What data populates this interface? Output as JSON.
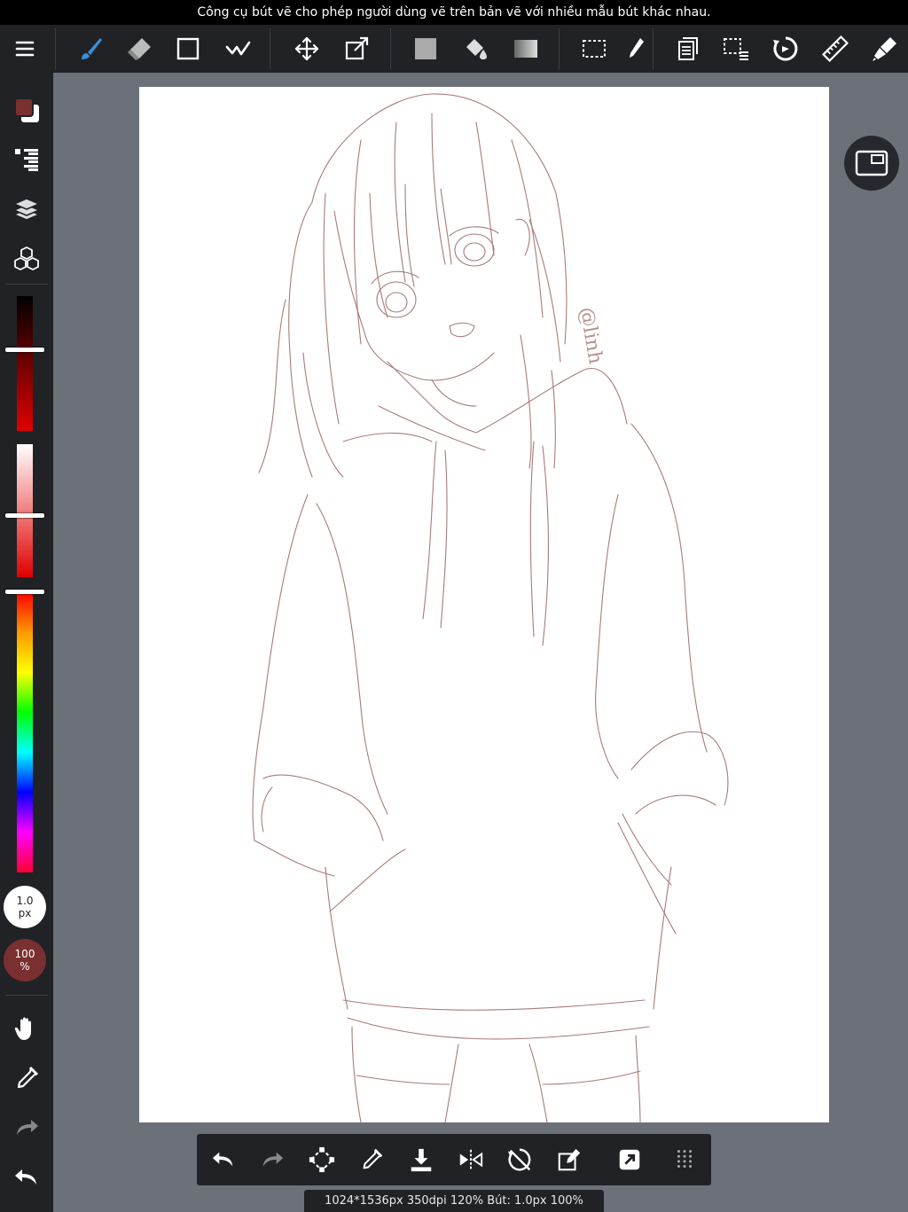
{
  "tooltip": "Công cụ bút vẽ cho phép người dùng vẽ trên bản vẽ với nhiều mẫu bút khác nhau.",
  "toolbar": {
    "tools": [
      "menu-icon",
      "brush-icon",
      "eraser-icon",
      "shape-icon",
      "operation-icon",
      "move-icon",
      "transform-icon",
      "fill-color-icon",
      "bucket-icon",
      "gradient-icon",
      "select-icon",
      "select-pen-icon",
      "copy-icon",
      "deselect-icon",
      "rotate-view-icon",
      "ruler-icon",
      "filter-icon"
    ],
    "selected_tool": "brush-icon",
    "brush_color": "#3a8fd6"
  },
  "sidebar": {
    "foreground_color": "#7a3030",
    "brush_size_label": "1.0\npx",
    "brush_size_value": "1.0",
    "brush_size_unit": "px",
    "opacity_value": "100",
    "opacity_unit": "%",
    "opacity_bg": "#7a3030",
    "hue_slider_level": 0.0,
    "saturation_slider_level": 0.55,
    "brightness_slider_level": 0.4
  },
  "canvas": {
    "signature": "@linh"
  },
  "bottombar": {
    "tools": [
      "undo-icon",
      "redo-icon",
      "transform-tool-icon",
      "eyedropper-icon",
      "save-icon",
      "flip-icon",
      "rotate-off-icon",
      "edit-icon",
      "share-icon",
      "grid-icon"
    ]
  },
  "status": "1024*1536px 350dpi 120% Bút: 1.0px 100%"
}
